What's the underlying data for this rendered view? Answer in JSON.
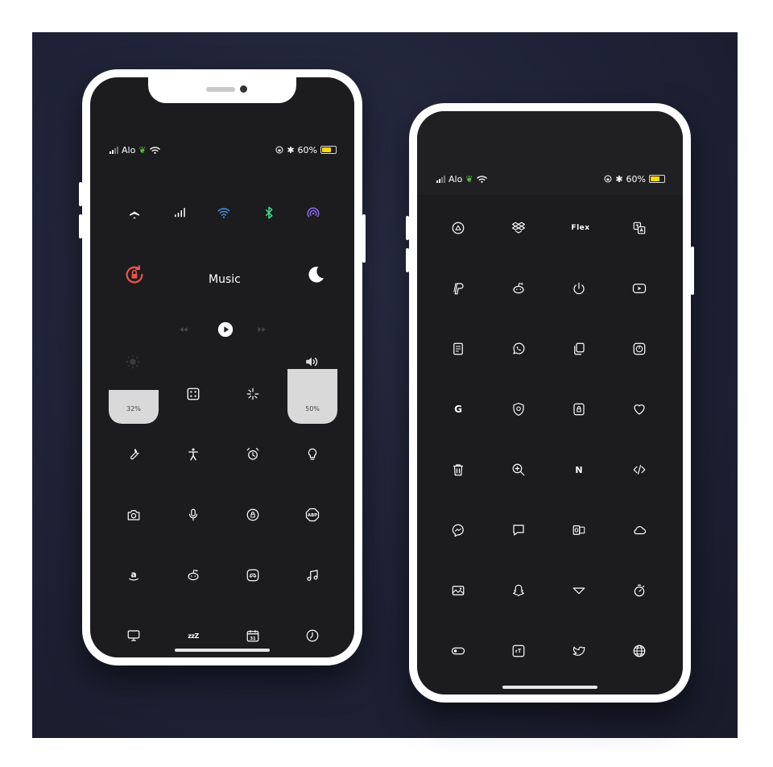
{
  "status_bar": {
    "carrier": "Alo",
    "battery": "60%"
  },
  "control_center": {
    "music_label": "Music",
    "brightness": "32%",
    "volume": "50%",
    "brightness_level": 0.32,
    "volume_level": 0.5
  },
  "colors": {
    "background": "#1f2236",
    "screen": "#1c1c1e",
    "wifi": "#4a90e2",
    "bluetooth": "#3ddc84",
    "airdrop": "#8e6cf0",
    "lock_rotation": "#e5534b",
    "battery": "#f5d90a"
  },
  "left_icons": [
    "wrench-icon",
    "accessibility-icon",
    "alarm-icon",
    "lightbulb-icon",
    "camera-icon",
    "microphone-icon",
    "lock-icon",
    "abp-icon",
    "amazon-icon",
    "reddit-icon",
    "game-icon",
    "music-note-icon",
    "monitor-icon",
    "sleep-icon",
    "calendar-icon",
    "clock-icon"
  ],
  "right_icons": [
    "drive-icon",
    "dropbox-icon",
    "flex-icon",
    "translate-icon",
    "paypal-icon",
    "reddit-icon",
    "power-icon",
    "youtube-icon",
    "notes-icon",
    "whatsapp-icon",
    "copy-icon",
    "authenticator-icon",
    "google-icon",
    "vpn-icon",
    "lock-icon",
    "heart-icon",
    "trash-icon",
    "zoom-icon",
    "netflix-icon",
    "code-icon",
    "messenger-icon",
    "message-icon",
    "outlook-icon",
    "cloud-icon",
    "gallery-icon",
    "snapchat-icon",
    "prime-icon",
    "timer-icon",
    "toggle-icon",
    "tetris-icon",
    "twitter-icon",
    "globe-icon"
  ],
  "labels": {
    "calendar_day": "31",
    "flex": "Flex",
    "google": "G",
    "netflix": "N",
    "amazon": "a",
    "abp": "ABP",
    "sleep": "zzZ"
  }
}
